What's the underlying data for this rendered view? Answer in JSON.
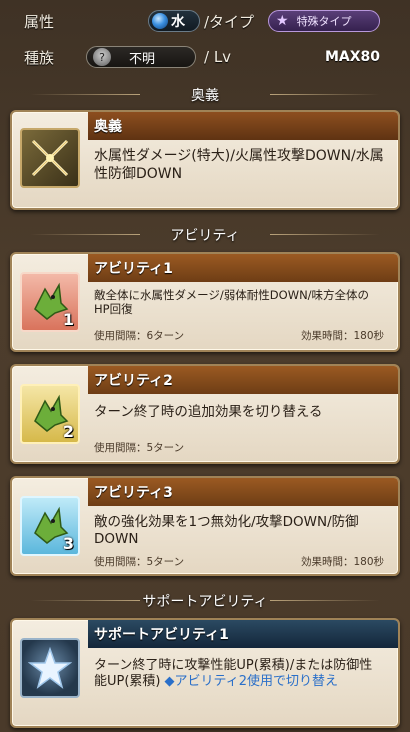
{
  "stats": {
    "attribute_label": "属性",
    "element": "水",
    "type_sep": "/タイプ",
    "type_value": "特殊タイプ",
    "race_label": "種族",
    "race_value": "不明",
    "lv_sep": "/ Lv",
    "max_lv": "MAX80"
  },
  "sections": {
    "ougi": "奥義",
    "abilities": "アビリティ",
    "support": "サポートアビリティ"
  },
  "ougi_card": {
    "title": "奥義",
    "desc": "水属性ダメージ(特大)/火属性攻撃DOWN/水属性防御DOWN"
  },
  "abilities": [
    {
      "title": "アビリティ1",
      "desc": "敵全体に水属性ダメージ/弱体耐性DOWN/味方全体のHP回復",
      "cooldown": "使用間隔：6ターン",
      "duration": "効果時間：180秒",
      "num": "1"
    },
    {
      "title": "アビリティ2",
      "desc": "ターン終了時の追加効果を切り替える",
      "cooldown": "使用間隔：5ターン",
      "duration": "",
      "num": "2"
    },
    {
      "title": "アビリティ3",
      "desc": "敵の強化効果を1つ無効化/攻撃DOWN/防御DOWN",
      "cooldown": "使用間隔：5ターン",
      "duration": "効果時間：180秒",
      "num": "3"
    }
  ],
  "support_card": {
    "title": "サポートアビリティ1",
    "desc": "ターン終了時に攻撃性能UP(累積)/または防御性能UP(累積)",
    "link": "◆アビリティ2使用で切り替え"
  },
  "colors": {
    "title_brown": "#8d4e1f",
    "title_blue": "#1f3850",
    "link_blue": "#2a6fc9"
  }
}
